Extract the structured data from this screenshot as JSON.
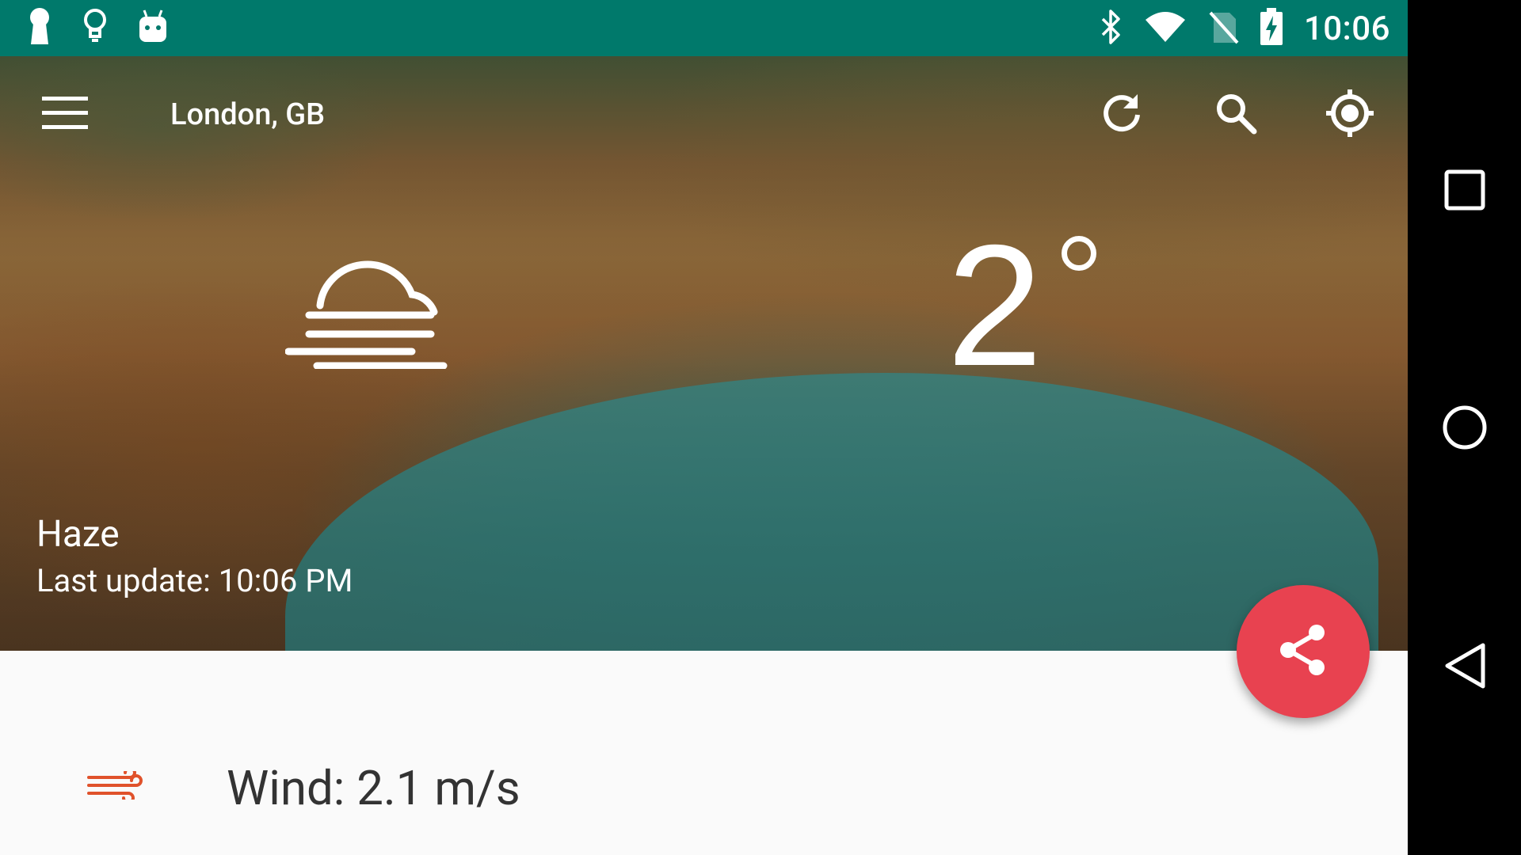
{
  "status_bar": {
    "time": "10:06",
    "left_icons": [
      "keyhole-icon",
      "lightbulb-icon",
      "android-icon"
    ],
    "right_icons": [
      "bluetooth-icon",
      "wifi-icon",
      "no-sim-icon",
      "battery-charging-icon"
    ]
  },
  "app_bar": {
    "title": "London, GB",
    "actions": [
      "refresh-icon",
      "search-icon",
      "my-location-icon"
    ]
  },
  "weather": {
    "temperature": "2",
    "condition": "Haze",
    "last_update": "Last update: 10:06 PM",
    "icon": "haze-icon"
  },
  "details": {
    "wind": "Wind: 2.1 m/s"
  },
  "fab": {
    "icon": "share-icon"
  },
  "colors": {
    "status_bar": "#00796b",
    "fab": "#e84250",
    "wind_icon": "#e0522b"
  }
}
